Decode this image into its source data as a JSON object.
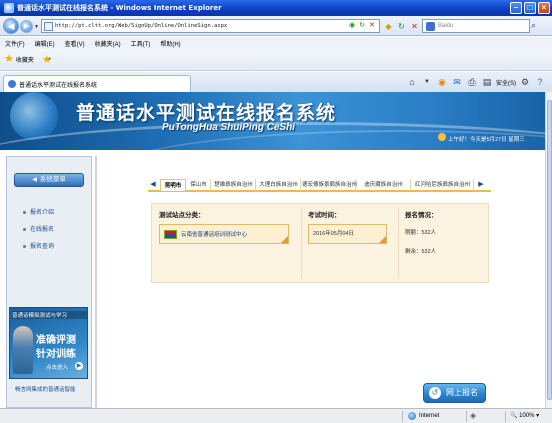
{
  "window": {
    "title": "普通话水平测试在线报名系统 - Windows Internet Explorer"
  },
  "addressbar": {
    "url": "http://pt.cltt.org/Web/SignUp/Online/OnlineSign.aspx",
    "search_placeholder": "Baidu"
  },
  "menu": [
    "文件(F)",
    "编辑(E)",
    "查看(V)",
    "收藏夹(A)",
    "工具(T)",
    "帮助(H)"
  ],
  "favorites": {
    "label": "收藏夹"
  },
  "tab": {
    "title": "普通话水平测试在线报名系统"
  },
  "commandbar": {
    "safety": "安全(S)"
  },
  "banner": {
    "title": "普通话水平测试在线报名系统",
    "subtitle": "PuTongHua ShuiPing CeShi",
    "date": "上午好！今天是5月27日  星期三"
  },
  "sidebar": {
    "header": "系统菜单",
    "items": [
      "报名介绍",
      "在线报名",
      "报名查询"
    ],
    "promo": {
      "title": "普通话模拟测试与学习",
      "line1": "准确评测",
      "line2": "针对训练",
      "cta": "点击进入"
    },
    "footer": "畅言网集成的普通话智能"
  },
  "region_tabs": [
    "昆明市",
    "保山市",
    "楚雄彝族自治州",
    "大理白族自治州",
    "德宏傣族景颇族自治州",
    "迪庆藏族自治州",
    "红河哈尼族彝族自治州"
  ],
  "panel": {
    "site_header": "测试站点分类：",
    "site_name": "云南省普通话培训测试中心",
    "time_header": "考试时间：",
    "date_value": "2016年05月04日",
    "reg_header": "报名情况：",
    "limit": "限额：532人",
    "remaining": "剩余：532人"
  },
  "register_button": "网上报名",
  "statusbar": {
    "zone": "Internet",
    "zoom": "100%"
  }
}
